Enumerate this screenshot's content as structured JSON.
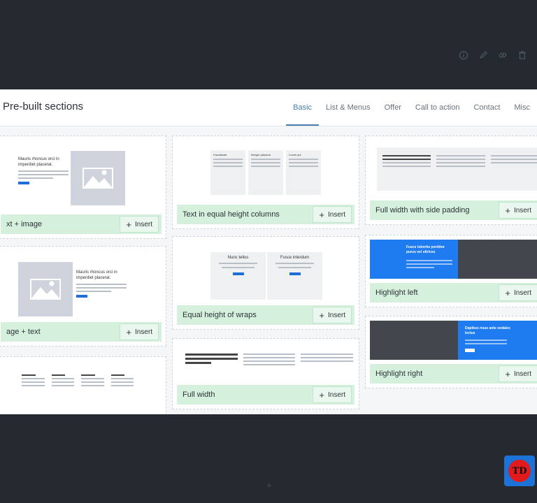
{
  "modal": {
    "title": "Pre-built sections",
    "tabs": [
      {
        "label": "Basic",
        "active": true
      },
      {
        "label": "List & Menus",
        "active": false
      },
      {
        "label": "Offer",
        "active": false
      },
      {
        "label": "Call to action",
        "active": false
      },
      {
        "label": "Contact",
        "active": false
      },
      {
        "label": "Misc",
        "active": false
      }
    ]
  },
  "insert_label": "Insert",
  "cards": {
    "text_image": "xt + image",
    "image_text": "age + text",
    "equal_columns": "Text in equal height columns",
    "equal_wraps": "Equal height of wraps",
    "full_width": "Full width",
    "full_width_padding": "Full width with side padding",
    "highlight_left": "Highlight left",
    "highlight_right": "Highlight right"
  },
  "thumbs": {
    "heading_a": "Mauris rhoncus orci in imperdiet placerat.",
    "col1": "Faucibusfe",
    "col2": "Integer placerat",
    "col3": "Lorem ips",
    "wrap1": "Nunc tellus",
    "wrap2": "Fusce interdum",
    "hl_left": "Fusce lobortis porttitor purus vel ultrices",
    "hl_right": "Dapibus risus ante sodales lectus"
  },
  "watermark": "TD",
  "colors": {
    "accent": "#4a7fb0",
    "insert_bg": "#d5f1dd",
    "highlight_blue": "#1e7bf0",
    "highlight_dark": "#42464d"
  }
}
